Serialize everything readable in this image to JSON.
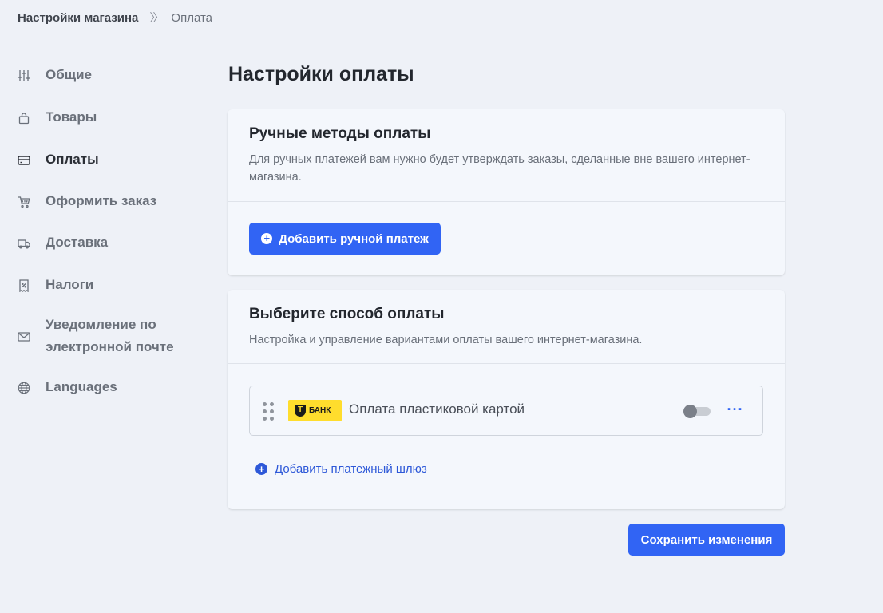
{
  "breadcrumb": {
    "root": "Настройки магазина",
    "separator": "»",
    "current": "Оплата"
  },
  "sidebar": {
    "items": [
      {
        "label": "Общие",
        "icon": "sliders-icon"
      },
      {
        "label": "Товары",
        "icon": "shopping-bag-icon"
      },
      {
        "label": "Оплаты",
        "icon": "credit-card-icon",
        "active": true
      },
      {
        "label": "Оформить заказ",
        "icon": "cart-icon"
      },
      {
        "label": "Доставка",
        "icon": "truck-icon"
      },
      {
        "label": "Налоги",
        "icon": "receipt-icon"
      },
      {
        "label": "Уведомление по электронной почте",
        "icon": "mail-icon"
      },
      {
        "label": "Languages",
        "icon": "globe-icon"
      }
    ]
  },
  "page": {
    "title": "Настройки оплаты"
  },
  "manual": {
    "title": "Ручные методы оплаты",
    "description": "Для ручных платежей вам нужно будет утверждать заказы, сделанные вне вашего интернет-магазина.",
    "add_button": "Добавить ручной платеж"
  },
  "methods": {
    "title": "Выберите способ оплаты",
    "description": "Настройка и управление вариантами оплаты вашего интернет-магазина.",
    "items": [
      {
        "name": "Оплата пластиковой картой",
        "logo_letter": "Т",
        "logo_text": "БАНК",
        "enabled": false,
        "more": "···"
      }
    ],
    "add_gateway": "Добавить платежный шлюз"
  },
  "actions": {
    "save": "Сохранить изменения"
  },
  "colors": {
    "accent": "#3164f4",
    "background": "#eef1f7",
    "card": "#f4f7fc",
    "logo_yellow": "#ffdd2d"
  }
}
